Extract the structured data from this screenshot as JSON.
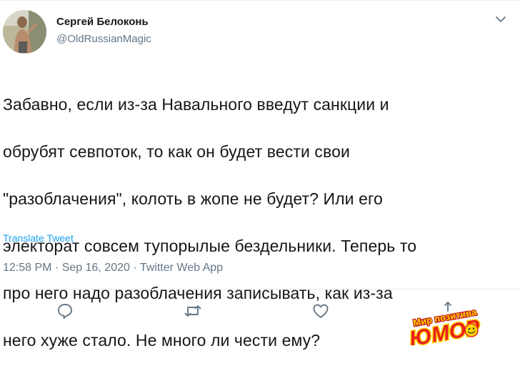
{
  "author": {
    "display_name": "Сергей Белоконь",
    "handle": "@OldRussianMagic"
  },
  "tweet": {
    "lines": [
      "Забавно, если из-за Навального введут санкции и",
      "обрубят севпоток, то как он будет вести свои",
      "\"разоблачения\", колоть в жопе не будет? Или его",
      "электорат совсем тупорылые бездельники. Теперь то",
      "про него надо разоблачения записывать, как из-за",
      "него хуже стало. Не много ли чести ему?"
    ],
    "translate_label": "Translate Tweet",
    "time": "12:58 PM",
    "separator": " · ",
    "date": "Sep 16, 2020",
    "source": "Twitter Web App"
  },
  "actions": {
    "icons": [
      "reply-icon",
      "retweet-icon",
      "like-icon",
      "share-icon"
    ]
  },
  "watermark": {
    "top_text": "Мир позитива",
    "bottom_text": "ЮМОР"
  },
  "colors": {
    "text": "#14171a",
    "secondary": "#657786",
    "link": "#1da1f2",
    "divider": "#e6ecf0",
    "watermark_red": "#e8231a",
    "watermark_yellow": "#ffd400"
  }
}
